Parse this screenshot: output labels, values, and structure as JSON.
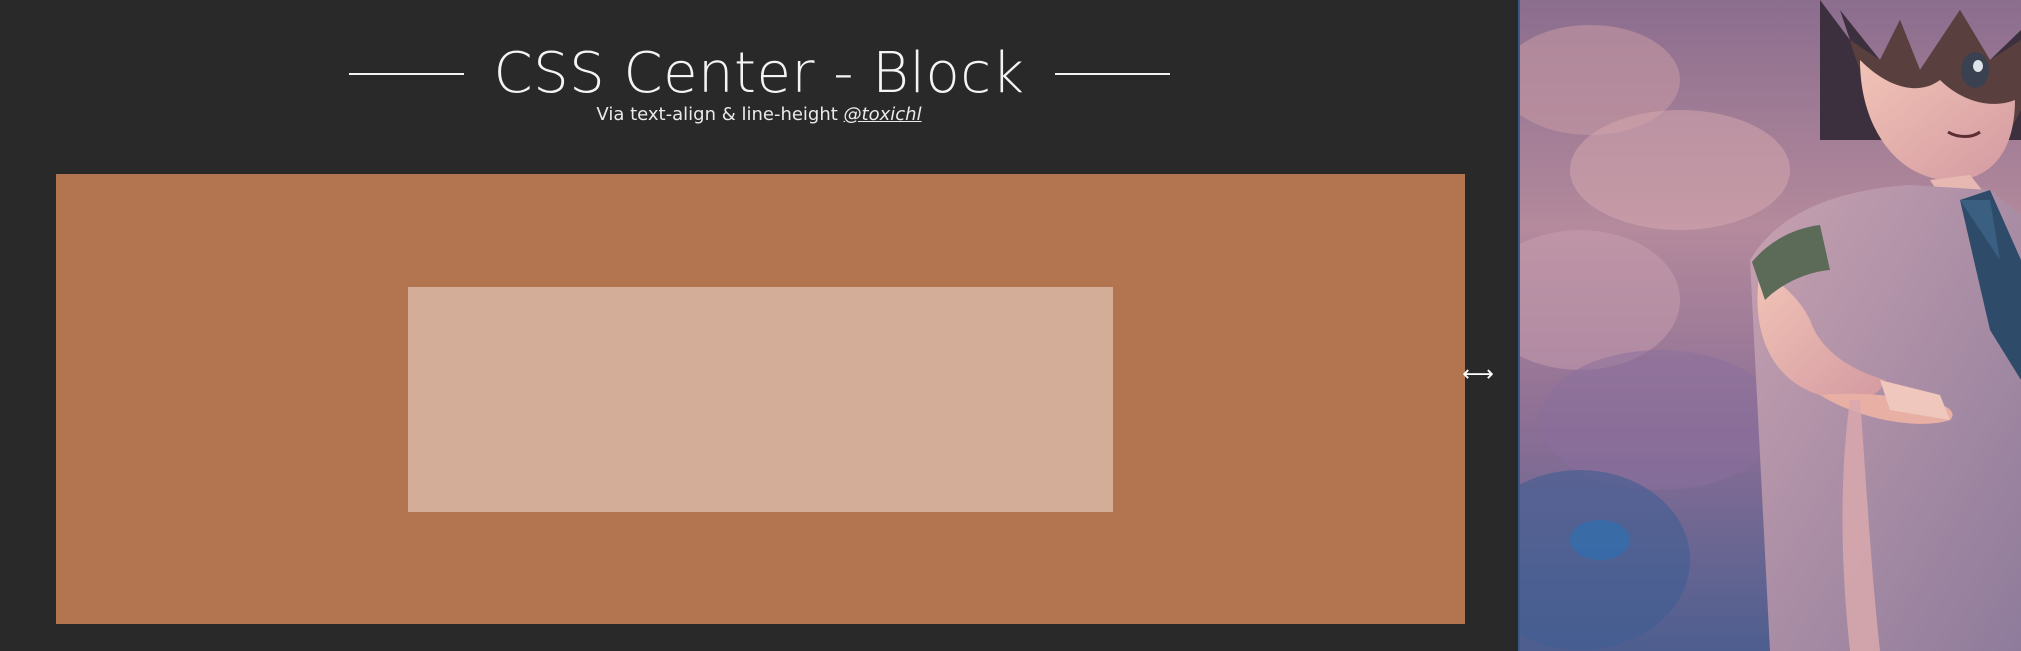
{
  "header": {
    "title": "CSS Center - Block",
    "subtitle_text": "Via text-align & line-height ",
    "author_link": "@toxichl"
  },
  "colors": {
    "page_background": "#292929",
    "outer_block": "#b27550",
    "inner_block": "#d3ad98",
    "text": "#f4f4f4"
  },
  "icons": {
    "resize_handle": "horizontal-resize-icon",
    "resize_glyph": "⟷"
  },
  "artwork": {
    "subject": "anime-character-illustration"
  }
}
